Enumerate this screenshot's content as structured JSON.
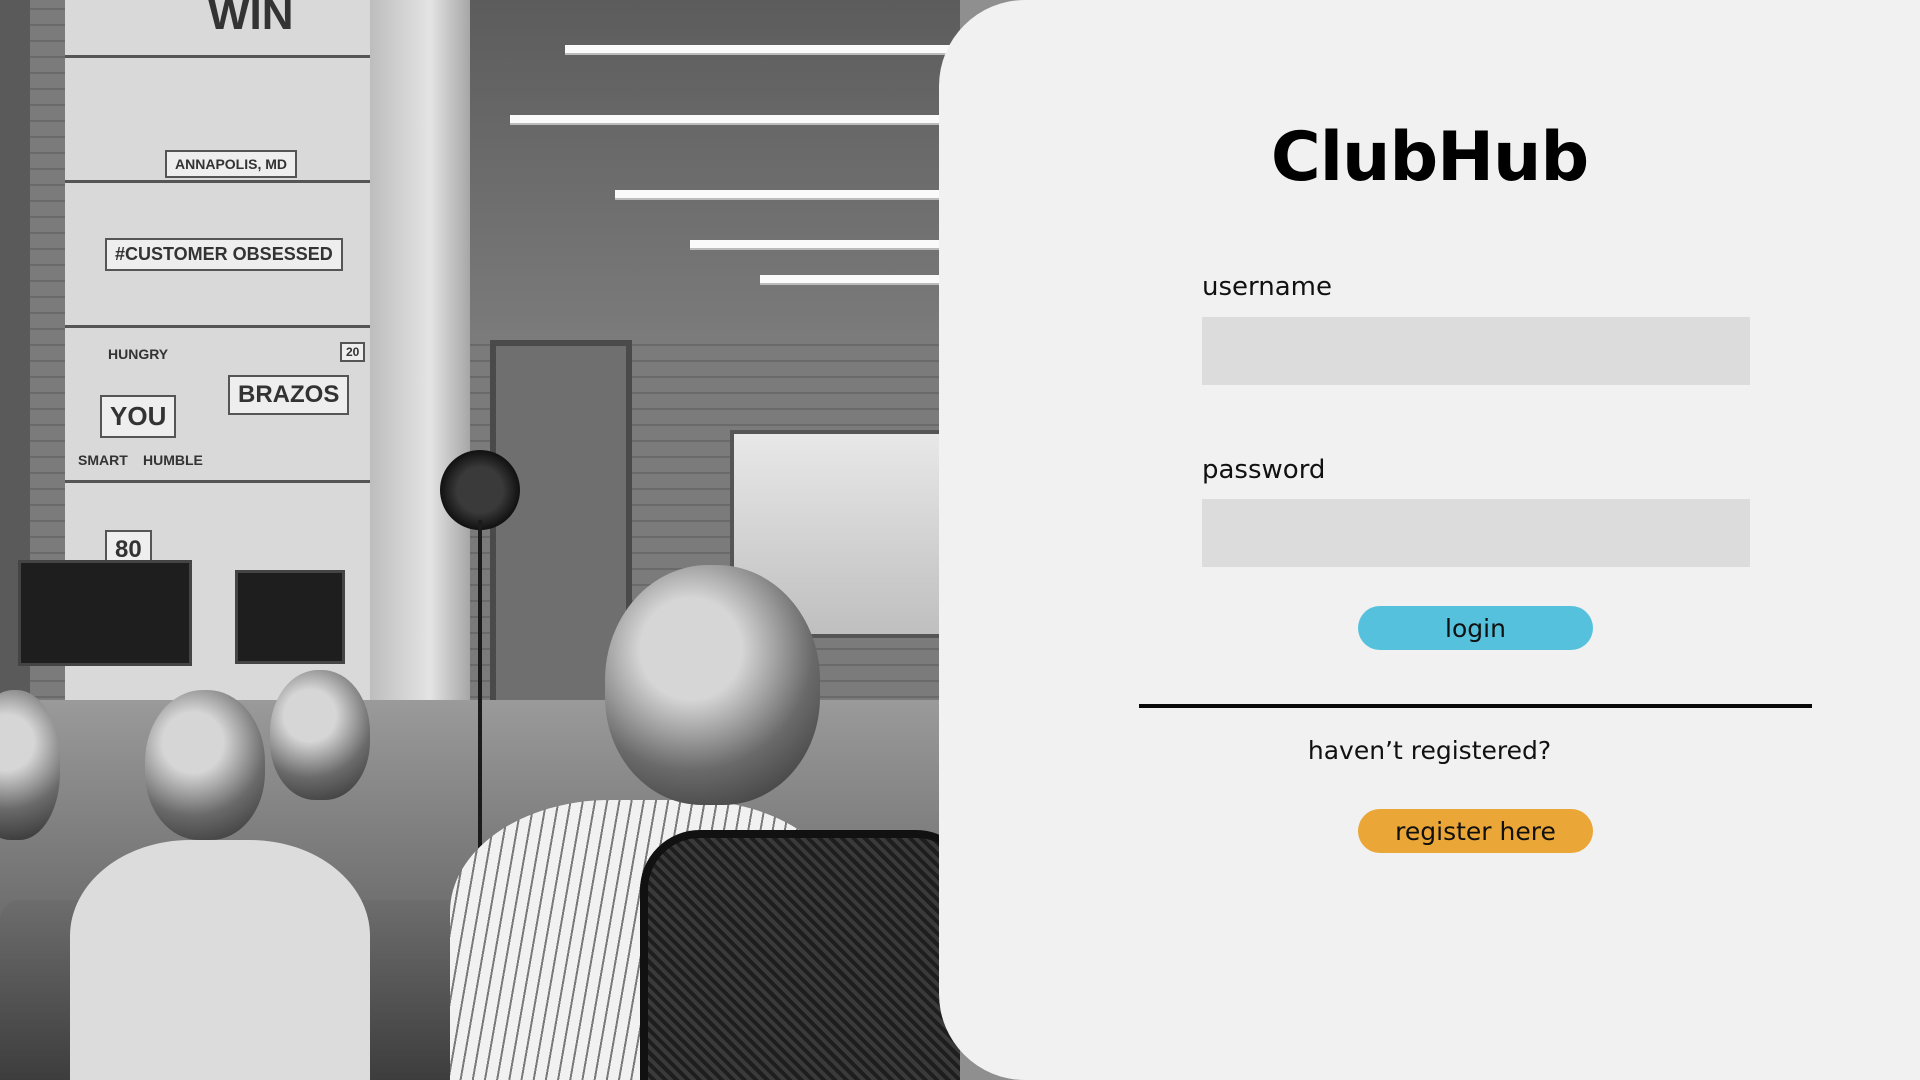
{
  "app": {
    "title": "ClubHub"
  },
  "colors": {
    "panel_background": "#f1f1f1",
    "input_background": "#dcdcdc",
    "login_button": "#55c1dc",
    "register_button": "#eaa636",
    "divider": "#0a0a0a"
  },
  "photo": {
    "description_icon": "office-photo-image",
    "mural_texts": [
      "WIN",
      "ANNAPOLIS, MD",
      "#CUSTOMER OBSESSED",
      "HUNGRY",
      "YOU",
      "SMART",
      "HUMBLE",
      "BRAZOS",
      "80",
      "20"
    ]
  },
  "login_form": {
    "username_label": "username",
    "username_value": "",
    "username_placeholder": "",
    "password_label": "password",
    "password_value": "",
    "password_placeholder": "",
    "login_button_label": "login"
  },
  "register": {
    "prompt": "haven’t registered?",
    "button_label": "register here"
  }
}
